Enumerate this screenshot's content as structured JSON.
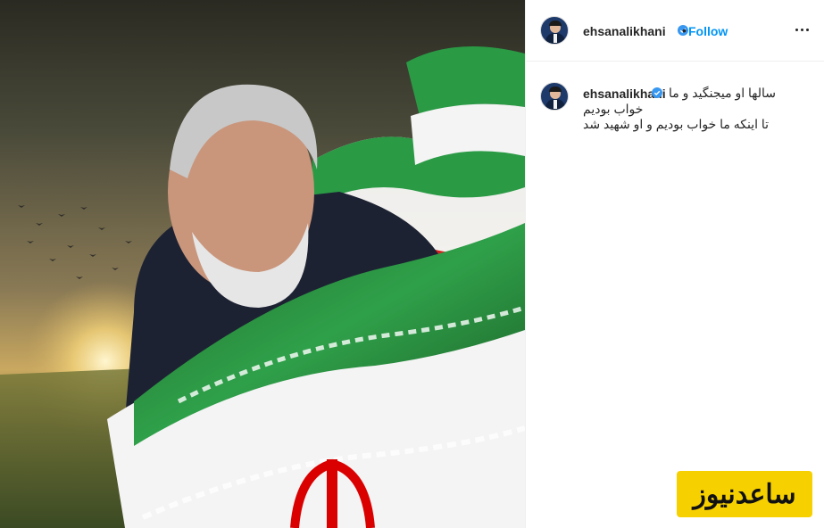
{
  "post": {
    "username": "ehsanalikhani",
    "follow_label": "Follow",
    "separator": "•",
    "caption": {
      "line1": "سالها او میجنگید و ما",
      "line2": "خواب بودیم",
      "line3": "تا اینکه ما خواب بودیم و او شهید شد"
    }
  },
  "icons": {
    "verified": "verified-badge-icon",
    "more": "more-options-icon"
  },
  "watermark": {
    "text": "ساعدنیوز"
  },
  "colors": {
    "follow": "#0095f6",
    "verified": "#3897f0",
    "watermark_bg": "#f7d000",
    "flag_green": "#239f40",
    "flag_red": "#da0000"
  }
}
